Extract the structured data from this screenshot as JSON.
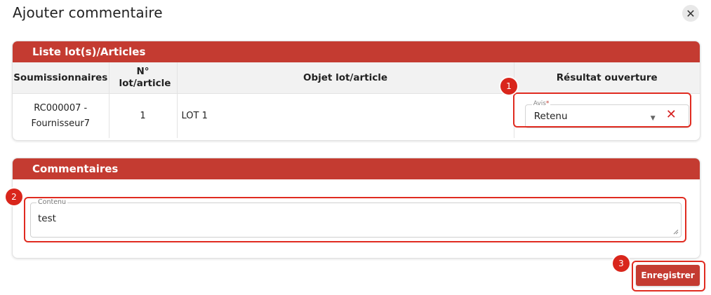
{
  "dialog": {
    "title": "Ajouter commentaire",
    "close_symbol": "✕"
  },
  "lots_section": {
    "header": "Liste lot(s)/Articles",
    "columns": [
      "Soumissionnaires",
      "N° lot/article",
      "Objet lot/article",
      "Résultat ouverture"
    ],
    "rows": [
      {
        "soumissionnaire": "RC000007 - Fournisseur7",
        "numero": "1",
        "objet": "LOT 1",
        "avis_label": "Avis",
        "avis_required": "*",
        "avis_value": "Retenu",
        "caret": "▼",
        "clear_symbol": "✕"
      }
    ]
  },
  "comments_section": {
    "header": "Commentaires",
    "contenu_label": "Contenu",
    "contenu_value": "test"
  },
  "actions": {
    "save_label": "Enregistrer"
  },
  "annotations": {
    "badges": [
      "1",
      "2",
      "3"
    ]
  },
  "colors": {
    "brand_red": "#c43b31",
    "highlight_red": "#e02b20",
    "clear_red": "#d62020"
  },
  "icons": {
    "close": "close-icon",
    "dropdown": "chevron-down-icon",
    "clear": "clear-icon",
    "resize": "resize-handle-icon"
  }
}
